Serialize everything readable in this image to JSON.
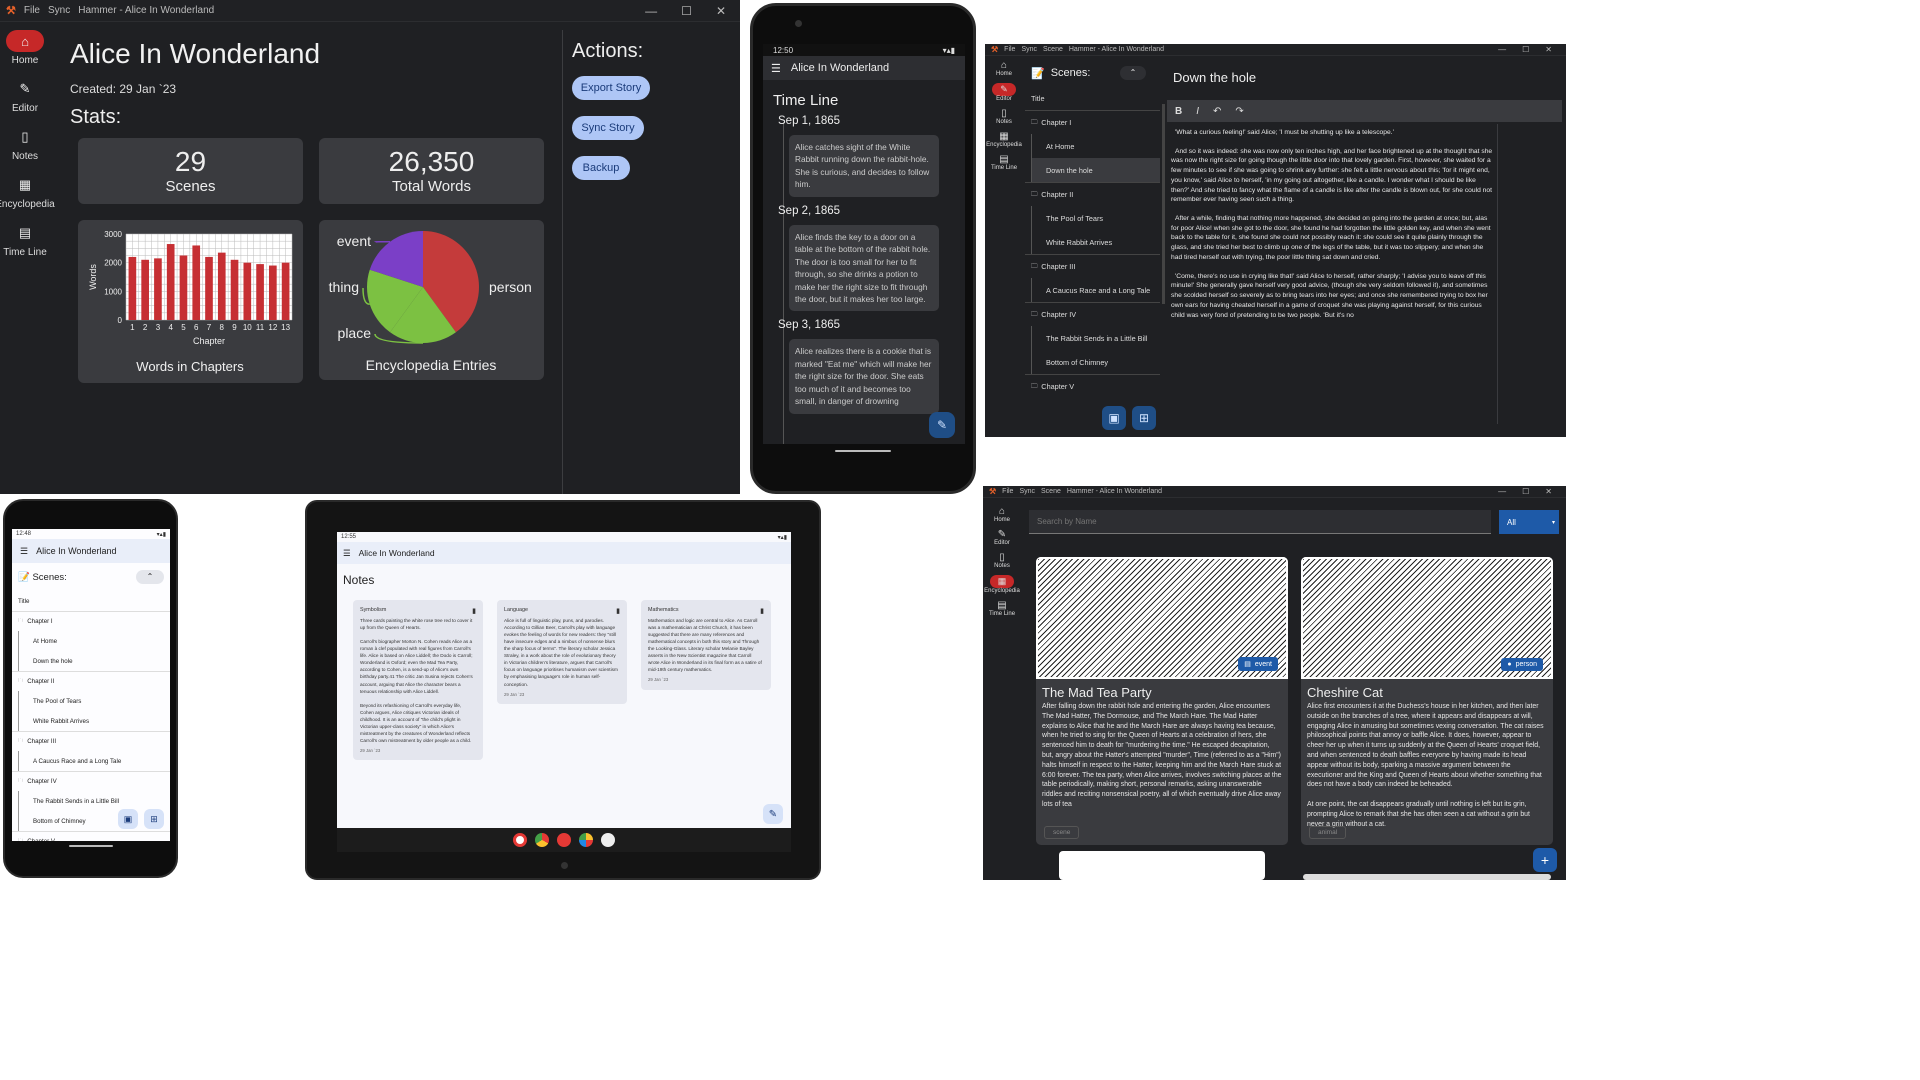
{
  "desktop_home": {
    "titlebar": {
      "menu_file": "File",
      "menu_sync": "Sync",
      "title": "Hammer - Alice In Wonderland",
      "min": "—",
      "max": "☐",
      "close": "✕"
    },
    "nav": [
      {
        "label": "Home",
        "icon": "home-icon"
      },
      {
        "label": "Editor",
        "icon": "pencil-icon"
      },
      {
        "label": "Notes",
        "icon": "phone-icon"
      },
      {
        "label": "Encyclopedia",
        "icon": "grid-icon"
      },
      {
        "label": "Time Line",
        "icon": "calendar-icon"
      }
    ],
    "story_title": "Alice In Wonderland",
    "created": "Created: 29 Jan `23",
    "stats_heading": "Stats:",
    "scenes_count": "29",
    "scenes_label": "Scenes",
    "words_count": "26,350",
    "words_label": "Total Words",
    "actions_heading": "Actions:",
    "actions": [
      "Export Story",
      "Sync Story",
      "Backup"
    ]
  },
  "chart_data": [
    {
      "type": "bar",
      "title": "Words in Chapters",
      "xlabel": "Chapter",
      "ylabel": "Words",
      "categories": [
        "1",
        "2",
        "3",
        "4",
        "5",
        "6",
        "7",
        "8",
        "9",
        "10",
        "11",
        "12",
        "13"
      ],
      "values": [
        2200,
        2100,
        2150,
        2650,
        2250,
        2600,
        2200,
        2350,
        2100,
        2000,
        1950,
        1900,
        2000
      ],
      "ylim": [
        0,
        3000
      ],
      "yticks": [
        "0",
        "1000",
        "2000",
        "3000"
      ],
      "grid": true,
      "color": "#c62f33"
    },
    {
      "type": "pie",
      "title": "Encyclopedia Entries",
      "labels": [
        "person",
        "place",
        "thing",
        "event"
      ],
      "values": [
        2,
        1,
        1,
        1
      ],
      "colors": [
        "#c43b3b",
        "#7cc142",
        "#7cc142",
        "#7b3fc7"
      ]
    }
  ],
  "phone_timeline": {
    "status_time": "12:50",
    "title": "Alice In Wonderland",
    "heading": "Time Line",
    "events": [
      {
        "date": "Sep 1, 1865",
        "text": "Alice catches sight of the White Rabbit running down the rabbit-hole. She is curious, and decides to follow him."
      },
      {
        "date": "Sep 2, 1865",
        "text": "Alice finds the key to a door on a table at the bottom of the rabbit hole. The door is too small for her to fit through, so she drinks a potion to make her the right size to fit through the door, but it makes her too large."
      },
      {
        "date": "Sep 3, 1865",
        "text": "Alice realizes there is a cookie that is marked \"Eat me\" which will make her the right size for the door. She eats too much of it and becomes too small, in danger of drowning"
      }
    ]
  },
  "editor_window": {
    "titlebar": {
      "menu_file": "File",
      "menu_sync": "Sync",
      "menu_scene": "Scene",
      "title": "Hammer - Alice In Wonderland"
    },
    "nav": [
      "Home",
      "Editor",
      "Notes",
      "Encyclopedia",
      "Time Line"
    ],
    "scenes_heading": "Scenes:",
    "scene_title": "Down the hole",
    "tree": [
      {
        "label": "Title",
        "level": 0
      },
      {
        "label": "Chapter I",
        "level": 0,
        "folder": true
      },
      {
        "label": "At Home",
        "level": 1
      },
      {
        "label": "Down the hole",
        "level": 1,
        "selected": true
      },
      {
        "label": "Chapter II",
        "level": 0,
        "folder": true
      },
      {
        "label": "The Pool of Tears",
        "level": 1
      },
      {
        "label": "White Rabbit Arrives",
        "level": 1
      },
      {
        "label": "Chapter III",
        "level": 0,
        "folder": true
      },
      {
        "label": "A Caucus Race and a Long Tale",
        "level": 1
      },
      {
        "label": "Chapter IV",
        "level": 0,
        "folder": true
      },
      {
        "label": "The Rabbit Sends in a Little Bill",
        "level": 1
      },
      {
        "label": "Bottom of Chimney",
        "level": 1
      },
      {
        "label": "Chapter V",
        "level": 0,
        "folder": true
      }
    ],
    "toolbar": {
      "bold": "B",
      "italic": "I",
      "undo": "↶",
      "redo": "↷"
    },
    "paragraphs": [
      "'What a curious feeling!' said Alice; 'I must be shutting up like a telescope.'",
      "And so it was indeed: she was now only ten inches high, and her face brightened up at the thought that she was now the right size for going though the little door into that lovely garden. First, however, she waited for a few minutes to see if she was going to shrink any further: she felt a little nervous about this; 'for it might end, you know,' said Alice to herself, 'in my going out altogether, like a candle. I wonder what I should be like then?' And she tried to fancy what the flame of a candle is like after the candle is blown out, for she could not remember ever having seen such a thing.",
      "After a while, finding that nothing more happened, she decided on going into the garden at once; but, alas for poor Alice! when she got to the door, she found he had forgotten the little golden key, and when she went back to the table for it, she found she could not possibly reach it: she could see it quite plainly through the glass, and she tried her best to climb up one of the legs of the table, but it was too slippery; and when she had tired herself out with trying, the poor little thing sat down and cried.",
      "'Come, there's no use in crying like that!' said Alice to herself, rather sharply; 'I advise you to leave off this minute!' She generally gave herself very good advice, (though she very seldom followed it), and sometimes she scolded herself so severely as to bring tears into her eyes; and once she remembered trying to box her own ears for having cheated herself in a game of croquet she was playing against herself, for this curious child was very fond of pretending to be two people. 'But it's no"
    ]
  },
  "phone_scenes": {
    "status_time": "12:48",
    "title": "Alice In Wonderland",
    "scenes_heading": "📝 Scenes:",
    "tree": [
      {
        "label": "Title",
        "level": 0
      },
      {
        "label": "Chapter I",
        "level": 0,
        "folder": true
      },
      {
        "label": "At Home",
        "level": 1
      },
      {
        "label": "Down the hole",
        "level": 1
      },
      {
        "label": "Chapter II",
        "level": 0,
        "folder": true
      },
      {
        "label": "The Pool of Tears",
        "level": 1
      },
      {
        "label": "White Rabbit Arrives",
        "level": 1
      },
      {
        "label": "Chapter III",
        "level": 0,
        "folder": true
      },
      {
        "label": "A Caucus Race and a Long Tale",
        "level": 1
      },
      {
        "label": "Chapter IV",
        "level": 0,
        "folder": true
      },
      {
        "label": "The Rabbit Sends in a Little Bill",
        "level": 1
      },
      {
        "label": "Bottom of Chimney",
        "level": 1
      },
      {
        "label": "Chapter V",
        "level": 0,
        "folder": true
      }
    ]
  },
  "tablet_notes": {
    "status_time": "12:55",
    "title": "Alice In Wonderland",
    "heading": "Notes",
    "notes": [
      {
        "title": "Symbolism",
        "body": "Three cards painting the white rose tree red to cover it up from the Queen of Hearts.\n\nCarroll's biographer Morton N. Cohen reads Alice as a roman à clef populated with real figures from Carroll's life. Alice is based on Alice Liddell; the Dodo is Carroll; Wonderland is Oxford; even the Mad Tea Party, according to Cohen, is a send-up of Alice's own birthday party.41 The critic Jan Susina rejects Cohen's account, arguing that Alice the character bears a tenuous relationship with Alice Liddell.\n\nBeyond its refashioning of Carroll's everyday life, Cohen argues, Alice critiques Victorian ideals of childhood. It is an account of \"the child's plight in Victorian upper-class society\" in which Alice's mistreatment by the creatures of Wonderland reflects Carroll's own mistreatment by older people as a child.",
        "date": "29 Jan `23"
      },
      {
        "title": "Language",
        "body": "Alice is full of linguistic play, puns, and parodies. According to Gillian Beer, Carroll's play with language evokes the feeling of words for new readers: they \"still have insecure edges and a nimbus of nonsense blurs the sharp focus of terms\". The literary scholar Jessica Straley, in a work about the role of evolutionary theory in Victorian children's literature, argues that Carroll's focus on language prioritises humanism over scientism by emphasising language's role in human self-conception.",
        "date": "29 Jan `23"
      },
      {
        "title": "Mathematics",
        "body": "Mathematics and logic are central to Alice. As Carroll was a mathematician at Christ Church, it has been suggested that there are many references and mathematical concepts in both this story and Through the Looking-Glass. Literary scholar Melanie Bayley asserts in the New Scientist magazine that Carroll wrote Alice in Wonderland in its final form as a satire of mid-19th century mathematics.",
        "date": "29 Jan `23"
      }
    ]
  },
  "encyclopedia_window": {
    "titlebar": {
      "menu_file": "File",
      "menu_sync": "Sync",
      "menu_scene": "Scene",
      "title": "Hammer - Alice In Wonderland"
    },
    "nav": [
      "Home",
      "Editor",
      "Notes",
      "Encyclopedia",
      "Time Line"
    ],
    "search_placeholder": "Search by Name",
    "filter": "All",
    "entries": [
      {
        "name": "The Mad Tea Party",
        "badge": "event",
        "tag": "scene",
        "description": "After falling down the rabbit hole and entering the garden, Alice encounters The Mad Hatter, The Dormouse, and The March Hare. The Mad Hatter explains to Alice that he and the March Hare are always having tea because, when he tried to sing for the Queen of Hearts at a celebration of hers, she sentenced him to death for \"murdering the time.\" He escaped decapitation, but, angry about the Hatter's attempted \"murder\", Time (referred to as a \"Him\") halts himself in respect to the Hatter, keeping him and the March Hare stuck at 6:00 forever. The tea party, when Alice arrives, involves switching places at the table periodically, making short, personal remarks, asking unanswerable riddles and reciting nonsensical poetry, all of which eventually drive Alice away lots of tea"
      },
      {
        "name": "Cheshire Cat",
        "badge": "person",
        "tag": "animal",
        "description": "Alice first encounters it at the Duchess's house in her kitchen, and then later outside on the branches of a tree, where it appears and disappears at will, engaging Alice in amusing but sometimes vexing conversation. The cat raises philosophical points that annoy or baffle Alice. It does, however, appear to cheer her up when it turns up suddenly at the Queen of Hearts' croquet field, and when sentenced to death baffles everyone by having made its head appear without its body, sparking a massive argument between the executioner and the King and Queen of Hearts about whether something that does not have a body can indeed be beheaded.\n\nAt one point, the cat disappears gradually until nothing is left but its grin, prompting Alice to remark that she has often seen a cat without a grin but never a grin without a cat."
      }
    ]
  }
}
